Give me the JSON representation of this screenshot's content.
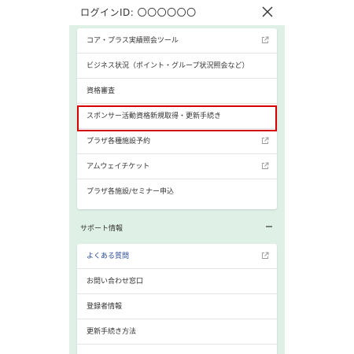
{
  "header": {
    "login_label": "ログインID: 〇〇〇〇〇〇"
  },
  "menu": {
    "items": [
      {
        "label": "コア・プラス実績照会ツール",
        "external": true
      },
      {
        "label": "ビジネス状況（ポイント・グループ状況照会など）",
        "external": false
      },
      {
        "label": "資格審査",
        "external": false
      },
      {
        "label": "スポンサー活動資格新規取得・更新手続き",
        "external": false,
        "highlighted": true
      },
      {
        "label": "プラザ各種施設予約",
        "external": true
      },
      {
        "label": "アムウェイチケット",
        "external": true
      },
      {
        "label": "プラザ各施設/セミナー申込",
        "external": false
      }
    ]
  },
  "support": {
    "title": "サポート情報",
    "items": [
      {
        "label": "よくある質問",
        "external": true,
        "link": true
      },
      {
        "label": "お問い合わせ窓口",
        "external": false
      },
      {
        "label": "登録者情報",
        "external": false
      },
      {
        "label": "更新手続き方法",
        "external": false
      }
    ]
  },
  "colors": {
    "background": "#dff0e7",
    "highlight": "#d40000",
    "link": "#2a4a9a"
  }
}
